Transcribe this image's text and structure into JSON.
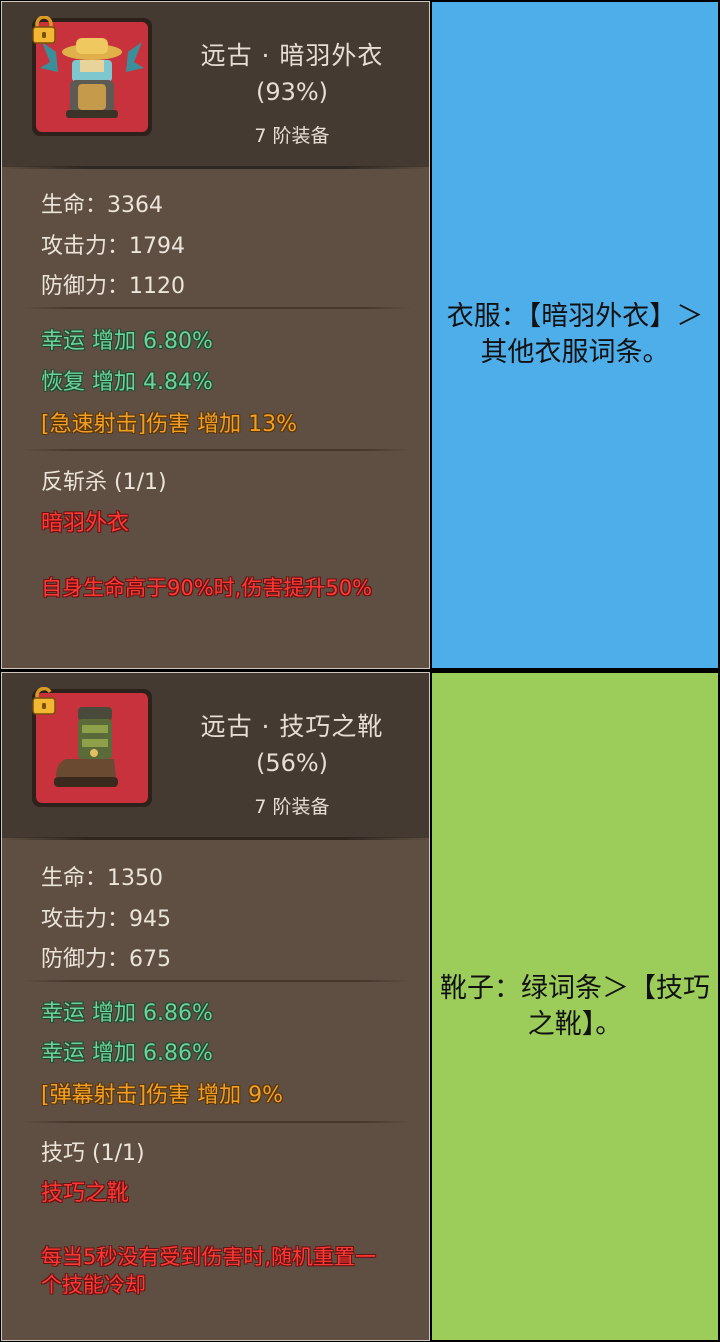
{
  "items": [
    {
      "title": "远古 · 暗羽外衣",
      "percent": "(93%)",
      "rank": "7 阶装备",
      "lock_state": "locked",
      "base_stats": [
        "生命：3364",
        "攻击力：1794",
        "防御力：1120"
      ],
      "affixes": [
        {
          "text": "幸运 增加 6.80%",
          "color": "green"
        },
        {
          "text": "恢复 增加 4.84%",
          "color": "green"
        },
        {
          "text": "[急速射击]伤害 增加 13%",
          "color": "orange"
        }
      ],
      "set_name": "反斩杀 (1/1)",
      "set_item": "暗羽外衣",
      "set_effect": "自身生命高于90%时,伤害提升50%",
      "note": "衣服：【暗羽外衣】＞其他衣服词条。",
      "note_color": "#4eaee9"
    },
    {
      "title": "远古 · 技巧之靴",
      "percent": "(56%)",
      "rank": "7 阶装备",
      "lock_state": "unlocked",
      "base_stats": [
        "生命：1350",
        "攻击力：945",
        "防御力：675"
      ],
      "affixes": [
        {
          "text": "幸运 增加 6.86%",
          "color": "green"
        },
        {
          "text": "幸运 增加 6.86%",
          "color": "green"
        },
        {
          "text": "[弹幕射击]伤害 增加 9%",
          "color": "orange"
        }
      ],
      "set_name": "技巧 (1/1)",
      "set_item": "技巧之靴",
      "set_effect": "每当5秒没有受到伤害时,随机重置一个技能冷却",
      "note": "靴子：绿词条＞【技巧之靴】。",
      "note_color": "#9ccc5a"
    }
  ]
}
